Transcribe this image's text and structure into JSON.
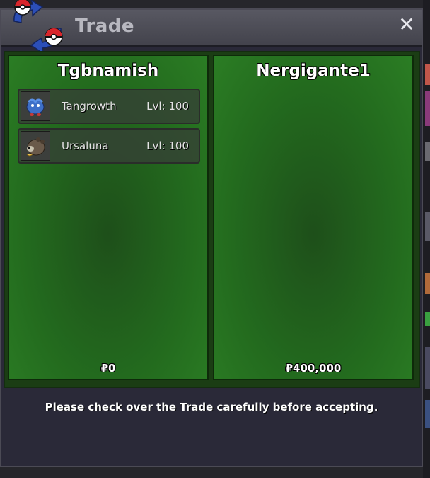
{
  "window": {
    "title": "Trade",
    "close_icon": "close-icon",
    "logo_icon": "pokeball-trade-arrows-icon"
  },
  "left_panel": {
    "player_name": "Tgbnamish",
    "money": "₽0",
    "items": [
      {
        "icon": "tangrowth-sprite-icon",
        "name": "Tangrowth",
        "level": "Lvl: 100"
      },
      {
        "icon": "ursaluna-sprite-icon",
        "name": "Ursaluna",
        "level": "Lvl: 100"
      }
    ]
  },
  "right_panel": {
    "player_name": "Nergigante1",
    "money": "₽400,000",
    "items": []
  },
  "footer": {
    "notice": "Please check over the Trade carefully before accepting."
  },
  "colors": {
    "panel_green": "#236b1e",
    "window_bg": "#2a2938",
    "titlebar": "#4b4b55"
  }
}
